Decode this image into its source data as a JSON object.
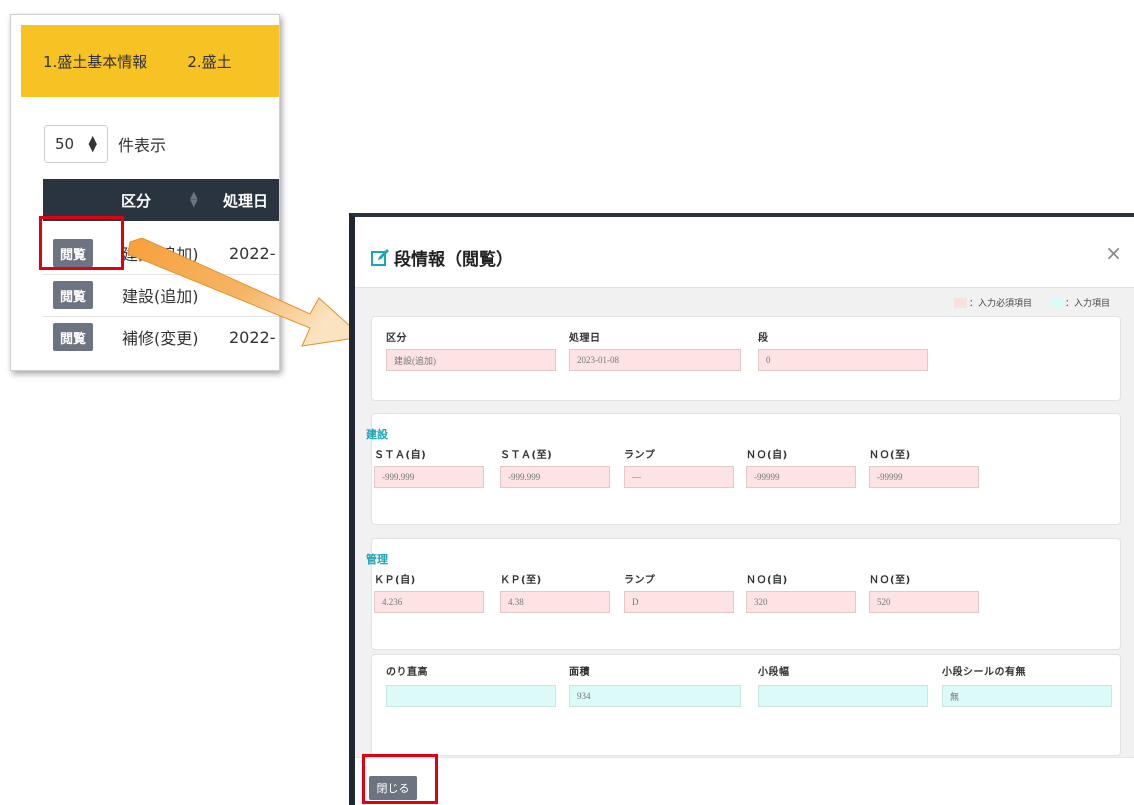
{
  "list": {
    "tabs": [
      "1.盛土基本情報",
      "2.盛土"
    ],
    "length_value": "50",
    "length_label": "件表示",
    "columns": {
      "kubun": "区分",
      "date": "処理日"
    },
    "rows": [
      {
        "button": "閲覧",
        "kubun": "建設(追加)",
        "date": "2022-"
      },
      {
        "button": "閲覧",
        "kubun": "建設(追加)",
        "date": ""
      },
      {
        "button": "閲覧",
        "kubun": "補修(変更)",
        "date": "2022-"
      }
    ]
  },
  "modal": {
    "title": "段情報（閲覧）",
    "close_symbol": "×",
    "legend": {
      "required": "：入力必須項目",
      "optional": "：入力項目"
    },
    "basic": {
      "kubun_label": "区分",
      "kubun_value": "建設(追加)",
      "date_label": "処理日",
      "date_value": "2023-01-08",
      "dan_label": "段",
      "dan_value": "0"
    },
    "kensetsu": {
      "title": "建設",
      "labels": [
        "ＳＴＡ(自)",
        "ＳＴＡ(至)",
        "ランプ",
        "ＮＯ(自)",
        "ＮＯ(至)"
      ],
      "values": [
        "-999.999",
        "-999.999",
        "—",
        "-99999",
        "-99999"
      ]
    },
    "kanri": {
      "title": "管理",
      "labels": [
        "ＫＰ(自)",
        "ＫＰ(至)",
        "ランプ",
        "ＮＯ(自)",
        "ＮＯ(至)"
      ],
      "values": [
        "4.236",
        "4.38",
        "D",
        "320",
        "520"
      ]
    },
    "extra": {
      "labels": [
        "のり直高",
        "面積",
        "小段幅",
        "小段シールの有無"
      ],
      "values": [
        "",
        "934",
        "",
        "無"
      ]
    },
    "footer_close": "閉じる"
  },
  "colors": {
    "tab_bar": "#f6c224",
    "table_header": "#2a3340",
    "accent": "#1ca4b7",
    "highlight": "#e00012",
    "required": "#fde3e3",
    "optional": "#dcfaf8"
  }
}
